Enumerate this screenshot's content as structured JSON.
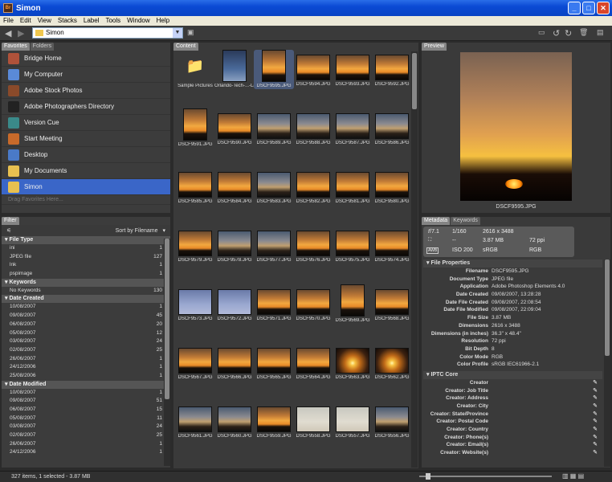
{
  "window": {
    "title": "Simon",
    "icon": "Br"
  },
  "menu": [
    "File",
    "Edit",
    "View",
    "Stacks",
    "Label",
    "Tools",
    "Window",
    "Help"
  ],
  "path": {
    "value": "Simon"
  },
  "tabs": {
    "favorites": "Favorites",
    "folders": "Folders",
    "content": "Content",
    "preview": "Preview",
    "filter": "Filter",
    "metadata": "Metadata",
    "keywords": "Keywords"
  },
  "favorites": [
    {
      "label": "Bridge Home",
      "icon": "bridge-home-icon",
      "color": "#b0523a"
    },
    {
      "label": "My Computer",
      "icon": "computer-icon",
      "color": "#5a8ad8"
    },
    {
      "label": "Adobe Stock Photos",
      "icon": "stock-photos-icon",
      "color": "#8a4a2a"
    },
    {
      "label": "Adobe Photographers Directory",
      "icon": "directory-icon",
      "color": "#222222"
    },
    {
      "label": "Version Cue",
      "icon": "version-cue-icon",
      "color": "#3a8a8a"
    },
    {
      "label": "Start Meeting",
      "icon": "meeting-icon",
      "color": "#c86a2a"
    },
    {
      "label": "Desktop",
      "icon": "desktop-icon",
      "color": "#4a7ac8"
    },
    {
      "label": "My Documents",
      "icon": "folder-icon",
      "color": "#e8c050"
    },
    {
      "label": "Simon",
      "icon": "folder-icon",
      "color": "#e8c050"
    }
  ],
  "favorites_hint": "Drag Favorites Here...",
  "sort_label": "Sort by Filename",
  "filter": {
    "sections": [
      {
        "title": "File Type",
        "rows": [
          [
            "ini",
            "1"
          ],
          [
            "JPEG file",
            "127"
          ],
          [
            "lnk",
            "1"
          ],
          [
            "pspimage",
            "1"
          ]
        ]
      },
      {
        "title": "Keywords",
        "rows": [
          [
            "No Keywords",
            "130"
          ]
        ]
      },
      {
        "title": "Date Created",
        "rows": [
          [
            "10/08/2007",
            "1"
          ],
          [
            "09/08/2007",
            "45"
          ],
          [
            "06/08/2007",
            "20"
          ],
          [
            "05/08/2007",
            "12"
          ],
          [
            "03/08/2007",
            "24"
          ],
          [
            "02/08/2007",
            "25"
          ],
          [
            "26/06/2007",
            "1"
          ],
          [
            "24/12/2006",
            "1"
          ],
          [
            "25/08/2006",
            "1"
          ]
        ]
      },
      {
        "title": "Date Modified",
        "rows": [
          [
            "10/08/2007",
            "1"
          ],
          [
            "09/08/2007",
            "51"
          ],
          [
            "06/08/2007",
            "15"
          ],
          [
            "05/08/2007",
            "11"
          ],
          [
            "03/08/2007",
            "24"
          ],
          [
            "02/08/2007",
            "25"
          ],
          [
            "26/06/2007",
            "1"
          ],
          [
            "24/12/2006",
            "1"
          ]
        ]
      }
    ]
  },
  "thumbs": [
    {
      "label": "Sample Pictures",
      "kind": "folder"
    },
    {
      "label": "Orlando-Tech-...-Launch-053.jpg",
      "kind": "launch"
    },
    {
      "label": "DSCF9595.JPG",
      "kind": "sunset"
    },
    {
      "label": "DSCF9594.JPG",
      "kind": "sunset"
    },
    {
      "label": "DSCF9593.JPG",
      "kind": "sunset"
    },
    {
      "label": "DSCF9592.JPG",
      "kind": "sunset"
    },
    {
      "label": "DSCF9591.JPG",
      "kind": "sunset"
    },
    {
      "label": "DSCF9590.JPG",
      "kind": "sunset"
    },
    {
      "label": "DSCF9589.JPG",
      "kind": "dusk"
    },
    {
      "label": "DSCF9588.JPG",
      "kind": "dusk"
    },
    {
      "label": "DSCF9587.JPG",
      "kind": "dusk"
    },
    {
      "label": "DSCF9586.JPG",
      "kind": "dusk"
    },
    {
      "label": "DSCF9585.JPG",
      "kind": "sunset"
    },
    {
      "label": "DSCF9584.JPG",
      "kind": "sunset"
    },
    {
      "label": "DSCF9583.JPG",
      "kind": "dusk"
    },
    {
      "label": "DSCF9582.JPG",
      "kind": "sunset"
    },
    {
      "label": "DSCF9581.JPG",
      "kind": "sunset"
    },
    {
      "label": "DSCF9580.JPG",
      "kind": "sunset"
    },
    {
      "label": "DSCF9579.JPG",
      "kind": "sunset"
    },
    {
      "label": "DSCF9578.JPG",
      "kind": "dusk"
    },
    {
      "label": "DSCF9577.JPG",
      "kind": "dusk"
    },
    {
      "label": "DSCF9576.JPG",
      "kind": "sunset"
    },
    {
      "label": "DSCF9575.JPG",
      "kind": "sunset"
    },
    {
      "label": "DSCF9574.JPG",
      "kind": "sunset"
    },
    {
      "label": "DSCF9573.JPG",
      "kind": "blue"
    },
    {
      "label": "DSCF9572.JPG",
      "kind": "blue"
    },
    {
      "label": "DSCF9571.JPG",
      "kind": "sunset"
    },
    {
      "label": "DSCF9570.JPG",
      "kind": "sunset"
    },
    {
      "label": "DSCF9569.JPG",
      "kind": "sunset"
    },
    {
      "label": "DSCF9568.JPG",
      "kind": "sunset"
    },
    {
      "label": "DSCF9567.JPG",
      "kind": "sunset"
    },
    {
      "label": "DSCF9566.JPG",
      "kind": "sunset"
    },
    {
      "label": "DSCF9565.JPG",
      "kind": "sunset"
    },
    {
      "label": "DSCF9564.JPG",
      "kind": "sunset"
    },
    {
      "label": "DSCF9563.JPG",
      "kind": "glow"
    },
    {
      "label": "DSCF9562.JPG",
      "kind": "glow"
    },
    {
      "label": "DSCF9561.JPG",
      "kind": "dusk"
    },
    {
      "label": "DSCF9560.JPG",
      "kind": "dusk"
    },
    {
      "label": "DSCF9559.JPG",
      "kind": "sunset"
    },
    {
      "label": "DSCF9558.JPG",
      "kind": "pale"
    },
    {
      "label": "DSCF9557.JPG",
      "kind": "pale"
    },
    {
      "label": "DSCF9556.JPG",
      "kind": "dusk"
    }
  ],
  "preview_label": "DSCF9595.JPG",
  "meta_head": {
    "fstop": "𝑓/7.1",
    "shutter": "1/160",
    "dims": "2616 x 3488",
    "dash": "--",
    "size": "3.87 MB",
    "ppi": "72 ppi",
    "iso": "ISO 200",
    "space": "sRGB",
    "mode": "RGB"
  },
  "file_properties": {
    "title": "File Properties",
    "rows": [
      [
        "Filename",
        "DSCF9595.JPG"
      ],
      [
        "Document Type",
        "JPEG file"
      ],
      [
        "Application",
        "Adobe Photoshop Elements 4.0"
      ],
      [
        "Date Created",
        "09/08/2007, 13:28:28"
      ],
      [
        "Date File Created",
        "09/08/2007, 22:08:54"
      ],
      [
        "Date File Modified",
        "09/08/2007, 22:09:04"
      ],
      [
        "File Size",
        "3.87 MB"
      ],
      [
        "Dimensions",
        "2616 x 3488"
      ],
      [
        "Dimensions (in inches)",
        "36.3\" x 48.4\""
      ],
      [
        "Resolution",
        "72 ppi"
      ],
      [
        "Bit Depth",
        "8"
      ],
      [
        "Color Mode",
        "RGB"
      ],
      [
        "Color Profile",
        "sRGB IEC61966-2.1"
      ]
    ]
  },
  "iptc": {
    "title": "IPTC Core",
    "rows": [
      "Creator",
      "Creator: Job Title",
      "Creator: Address",
      "Creator: City",
      "Creator: State/Province",
      "Creator: Postal Code",
      "Creator: Country",
      "Creator: Phone(s)",
      "Creator: Email(s)",
      "Creator: Website(s)"
    ]
  },
  "status": "327 items, 1 selected - 3.87 MB"
}
